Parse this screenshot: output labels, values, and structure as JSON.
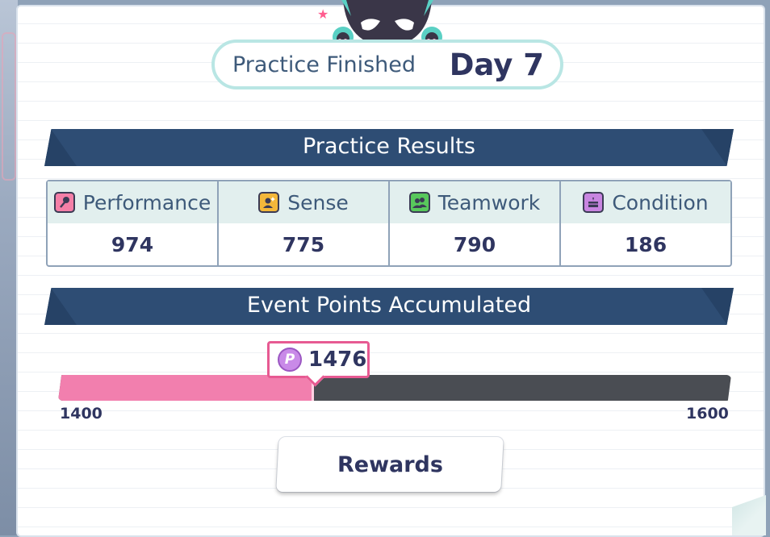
{
  "header": {
    "label": "Practice Finished",
    "day": "Day 7"
  },
  "results": {
    "title": "Practice Results",
    "stats": [
      {
        "name": "Performance",
        "value": "974",
        "icon": "microphone-icon",
        "color": "#f47fa7"
      },
      {
        "name": "Sense",
        "value": "775",
        "icon": "person-sparkle-icon",
        "color": "#f3b73a"
      },
      {
        "name": "Teamwork",
        "value": "790",
        "icon": "two-people-icon",
        "color": "#58c85c"
      },
      {
        "name": "Condition",
        "value": "186",
        "icon": "cake-icon",
        "color": "#c885e0"
      }
    ]
  },
  "event_points": {
    "title": "Event Points Accumulated",
    "current": "1476",
    "min": "1400",
    "max": "1600",
    "progress_fraction": 0.38,
    "icon": "point-coin-icon"
  },
  "rewards_label": "Rewards",
  "colors": {
    "accent": "#2e4d74",
    "progress": "#f27fae",
    "text": "#2f3560"
  }
}
